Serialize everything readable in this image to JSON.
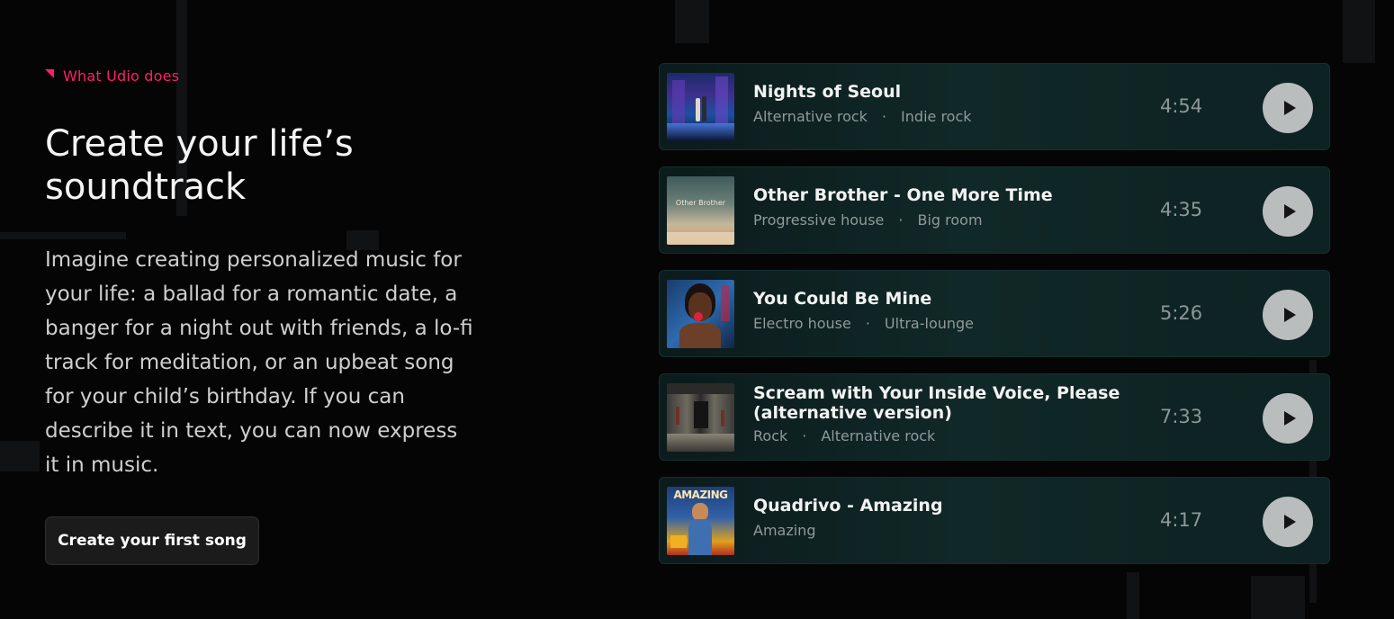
{
  "section": {
    "eyebrow": "What Udio does",
    "headline": "Create your life’s soundtrack",
    "body": "Imagine creating personalized music for your life: a ballad for a romantic date, a banger for a night out with friends, a lo-fi track for meditation, or an upbeat song for your child’s birthday. If you can describe it in text, you can now express it in music.",
    "cta_label": "Create your first song"
  },
  "songs": [
    {
      "title": "Nights of Seoul",
      "tags": [
        "Alternative rock",
        "Indie rock"
      ],
      "duration": "4:54",
      "cover_icon": "city-night-couple-cover"
    },
    {
      "title": "Other Brother - One More Time",
      "tags": [
        "Progressive house",
        "Big room"
      ],
      "duration": "4:35",
      "cover_icon": "vintage-album-cover",
      "cover_text": "Other Brother"
    },
    {
      "title": "You Could Be Mine",
      "tags": [
        "Electro house",
        "Ultra-lounge"
      ],
      "duration": "5:26",
      "cover_icon": "portrait-lollipop-cover"
    },
    {
      "title": "Scream with Your Inside Voice, Please (alternative version)",
      "tags": [
        "Rock",
        "Alternative rock"
      ],
      "duration": "7:33",
      "cover_icon": "dark-corridor-cover"
    },
    {
      "title": "Quadrivo - Amazing",
      "tags": [
        "Amazing"
      ],
      "duration": "4:17",
      "cover_icon": "comic-woman-cover",
      "cover_text": "AMAZING"
    }
  ],
  "colors": {
    "accent": "#ff1f6b",
    "background": "#050505",
    "card": "#102827",
    "play_button": "#b9bdbd"
  }
}
